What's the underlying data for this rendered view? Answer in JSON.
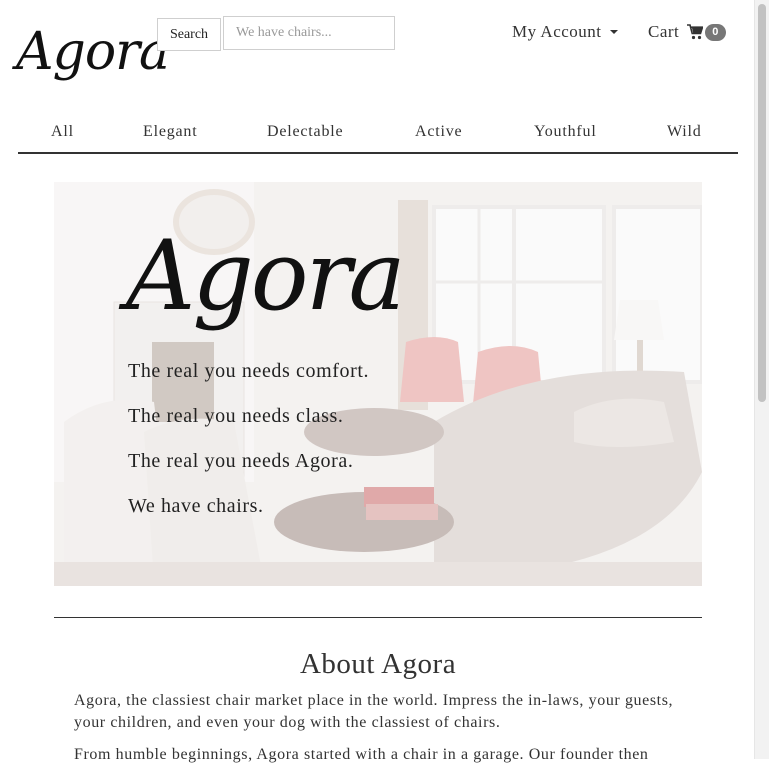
{
  "header": {
    "logo": "Agora",
    "search_button": "Search",
    "search_placeholder": "We have chairs...",
    "account_label": "My Account",
    "cart_label": "Cart",
    "cart_count": "0"
  },
  "nav": {
    "items": [
      "All",
      "Elegant",
      "Delectable",
      "Active",
      "Youthful",
      "Wild"
    ]
  },
  "hero": {
    "logo": "Agora",
    "taglines": [
      "The real you needs comfort.",
      "The real you needs class.",
      "The real you needs Agora.",
      "We have chairs."
    ]
  },
  "about": {
    "title": "About Agora",
    "paragraphs": [
      "Agora, the classiest chair market place in the world. Impress the in-laws, your guests, your children, and even your dog with the classiest of chairs.",
      "From humble beginnings, Agora started with a chair in a garage. Our founder then"
    ]
  },
  "colors": {
    "text": "#333333",
    "badge": "#777777",
    "divider": "#333333"
  }
}
